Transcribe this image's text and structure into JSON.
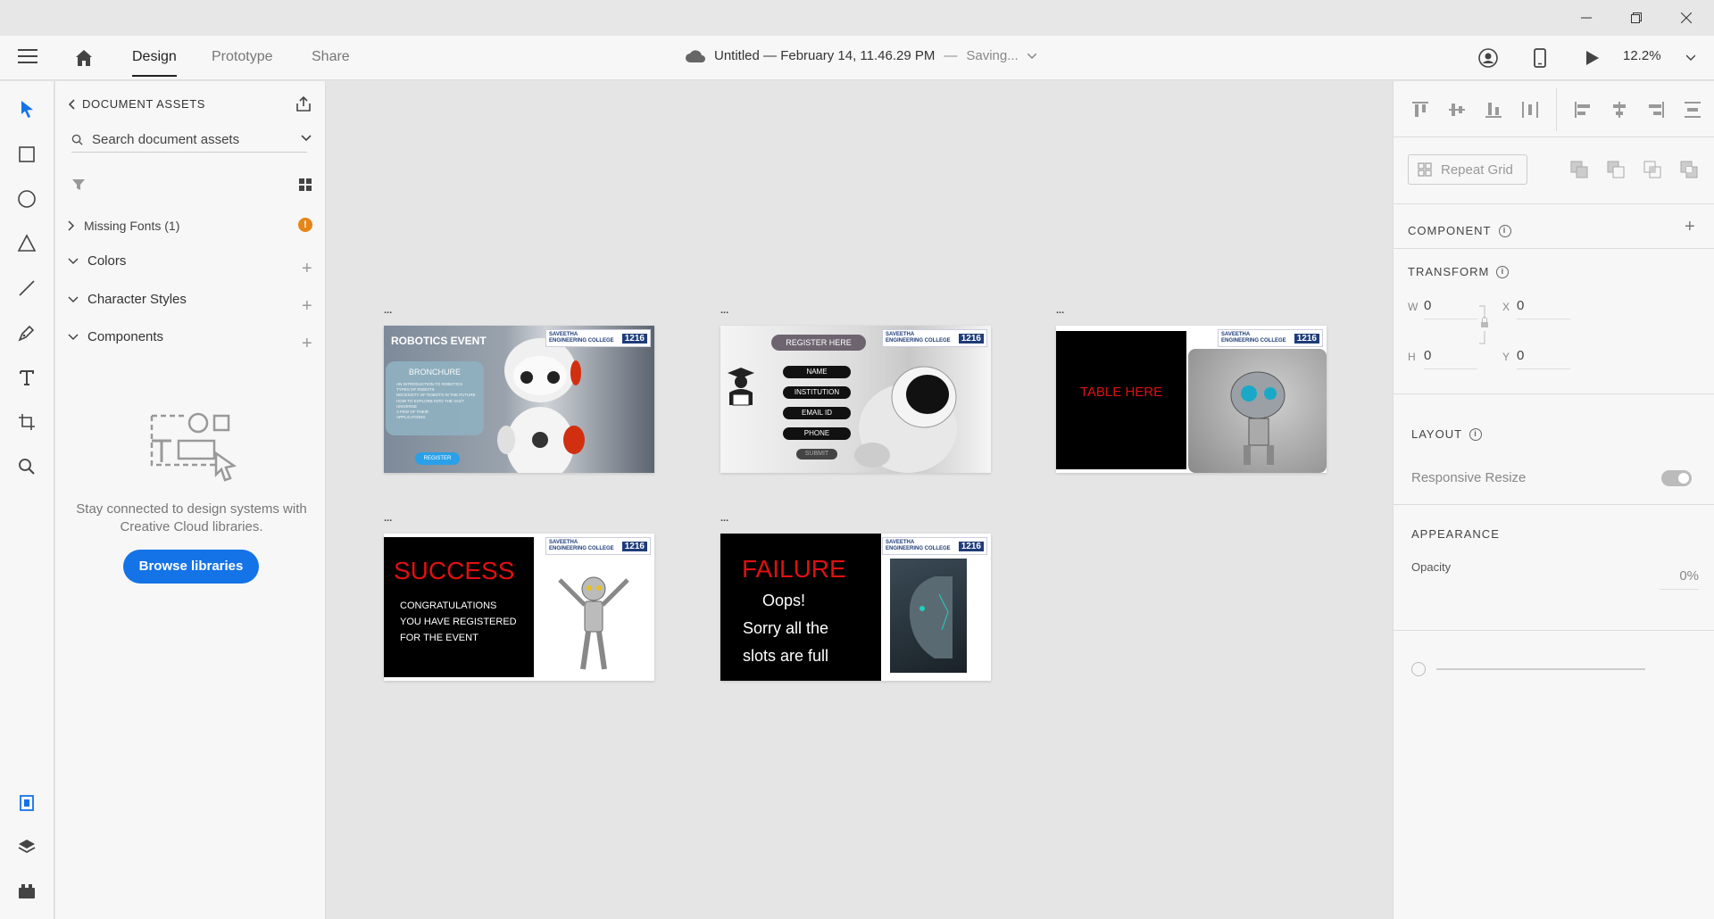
{
  "titlebar": {
    "minimize": "—",
    "maximize": "❐",
    "close": "✕"
  },
  "header": {
    "tabs": [
      {
        "label": "Design",
        "active": true
      },
      {
        "label": "Prototype",
        "active": false
      },
      {
        "label": "Share",
        "active": false
      }
    ],
    "doc_title": "Untitled — February 14, 11.46.29 PM",
    "doc_sep": "—",
    "doc_status": "Saving...",
    "zoom": "12.2%"
  },
  "assets": {
    "title": "DOCUMENT ASSETS",
    "search_placeholder": "Search document assets",
    "missing_fonts": "Missing Fonts (1)",
    "warning": "!",
    "sections": [
      "Colors",
      "Character Styles",
      "Components"
    ],
    "empty_text": "Stay connected to design systems with Creative Cloud libraries.",
    "browse_label": "Browse libraries"
  },
  "artboards": [
    {
      "label": "...",
      "title": "ROBOTICS EVENT",
      "card_title": "BRONCHURE",
      "card_lines": [
        "AN INTRODUCTION TO ROBOTICS",
        "TYPES OF ROBOTS",
        "NECESSITY OF ROBOTS IN THE FUTURE",
        "HOW TO EXPLORE INTO THE VAST",
        "UNIVERSE",
        "A FEW OF THEIR",
        "APPLICATIONS"
      ],
      "button": "REGISTER"
    },
    {
      "label": "...",
      "header": "REGISTER HERE",
      "fields": [
        "NAME",
        "INSTITUTION",
        "EMAIL ID",
        "PHONE"
      ],
      "submit": "SUBMIT"
    },
    {
      "label": "...",
      "text": "TABLE HERE"
    },
    {
      "label": "...",
      "title": "SUCCESS",
      "lines": [
        "CONGRATULATIONS",
        "YOU HAVE REGISTERED",
        "FOR THE EVENT"
      ]
    },
    {
      "label": "...",
      "title": "FAILURE",
      "lines": [
        "Oops!",
        "Sorry all the",
        "slots are full"
      ]
    }
  ],
  "logo": {
    "name_line1": "SAVEETHA",
    "name_line2": "ENGINEERING COLLEGE",
    "code": "1216"
  },
  "props": {
    "repeat_grid": "Repeat Grid",
    "component_title": "COMPONENT",
    "transform_title": "TRANSFORM",
    "w_label": "W",
    "w_value": "0",
    "h_label": "H",
    "h_value": "0",
    "x_label": "X",
    "x_value": "0",
    "y_label": "Y",
    "y_value": "0",
    "layout_title": "LAYOUT",
    "responsive_resize": "Responsive Resize",
    "appearance_title": "APPEARANCE",
    "opacity_label": "Opacity",
    "opacity_value": "0%"
  },
  "colors": {
    "accent": "#1473e6",
    "warning": "#e68619",
    "danger_red": "#e01010"
  }
}
